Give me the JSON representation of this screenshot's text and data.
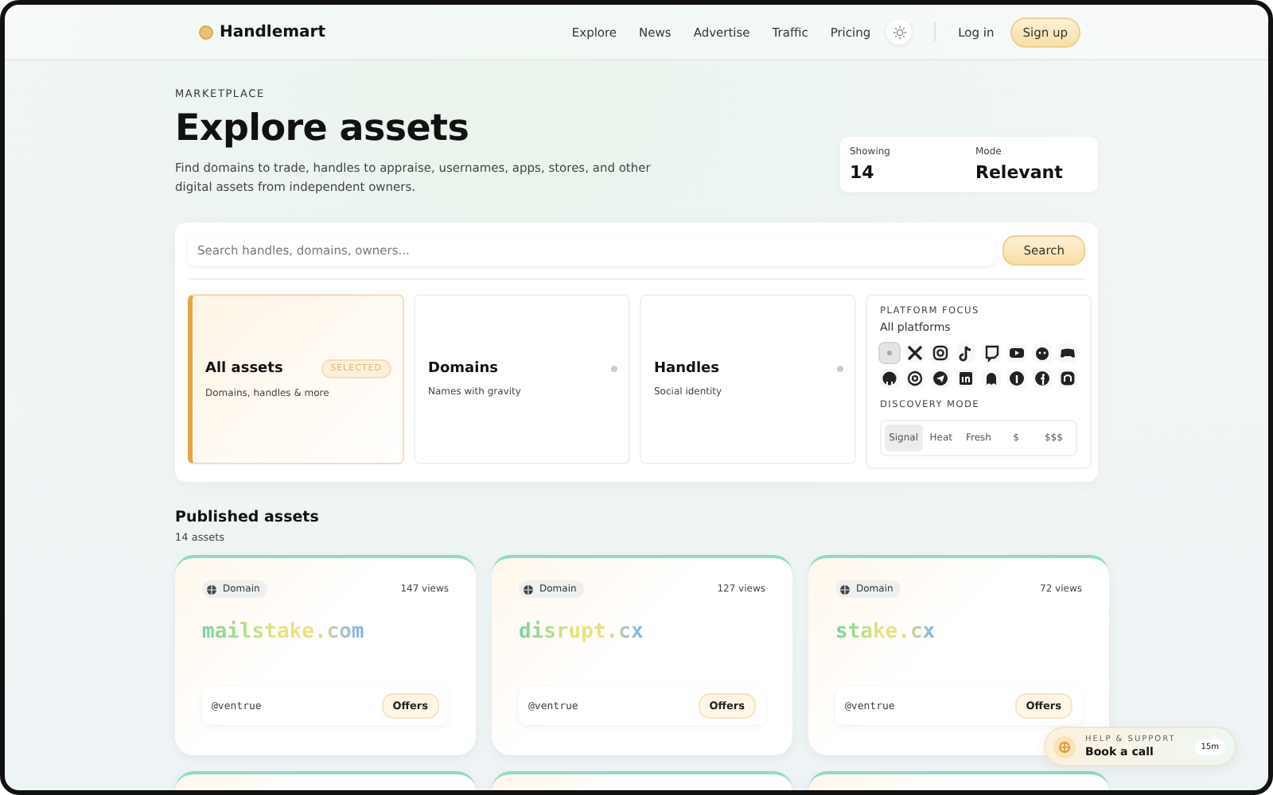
{
  "brand": "Handlemart",
  "nav": [
    "Explore",
    "News",
    "Advertise",
    "Traffic",
    "Pricing"
  ],
  "login": "Log in",
  "signup": "Sign up",
  "hero": {
    "eyebrow": "MARKETPLACE",
    "title": "Explore assets",
    "description": "Find domains to trade, handles to appraise, usernames, apps, stores, and other digital assets from independent owners."
  },
  "stats": [
    {
      "label": "Showing",
      "value": "14"
    },
    {
      "label": "Mode",
      "value": "Relevant"
    }
  ],
  "search": {
    "placeholder": "Search handles, domains, owners...",
    "button": "Search"
  },
  "categories": [
    {
      "title": "All assets",
      "subtitle": "Domains, handles & more",
      "selected": true,
      "badge": "SELECTED"
    },
    {
      "title": "Domains",
      "subtitle": "Names with gravity",
      "selected": false
    },
    {
      "title": "Handles",
      "subtitle": "Social identity",
      "selected": false
    }
  ],
  "platform_focus": {
    "heading": "PLATFORM FOCUS",
    "value": "All platforms",
    "platforms": [
      {
        "selected": true
      },
      {
        "selected": false
      },
      {
        "selected": false
      },
      {
        "selected": false
      },
      {
        "selected": false
      },
      {
        "selected": false
      },
      {
        "selected": false
      },
      {
        "selected": false
      },
      {
        "selected": false
      },
      {
        "selected": false
      },
      {
        "selected": false
      },
      {
        "selected": false
      },
      {
        "selected": false
      },
      {
        "selected": false
      },
      {
        "selected": false
      },
      {
        "selected": false
      }
    ]
  },
  "discovery_mode": {
    "heading": "DISCOVERY MODE",
    "modes": [
      {
        "label": "Signal",
        "selected": true
      },
      {
        "label": "Heat",
        "selected": false
      },
      {
        "label": "Fresh",
        "selected": false
      },
      {
        "label": "$",
        "selected": false
      },
      {
        "label": "$$$",
        "selected": false
      }
    ]
  },
  "published": {
    "title": "Published assets",
    "count": "14 assets"
  },
  "assets": [
    {
      "type": "Domain",
      "views": "147 views",
      "name": "mailstake.com",
      "owner": "@ventrue",
      "action": "Offers"
    },
    {
      "type": "Domain",
      "views": "127 views",
      "name": "disrupt.cx",
      "owner": "@ventrue",
      "action": "Offers"
    },
    {
      "type": "Domain",
      "views": "72 views",
      "name": "stake.cx",
      "owner": "@ventrue",
      "action": "Offers"
    }
  ],
  "support": {
    "eyebrow": "HELP & SUPPORT",
    "title": "Book a call",
    "badge": "15m"
  }
}
